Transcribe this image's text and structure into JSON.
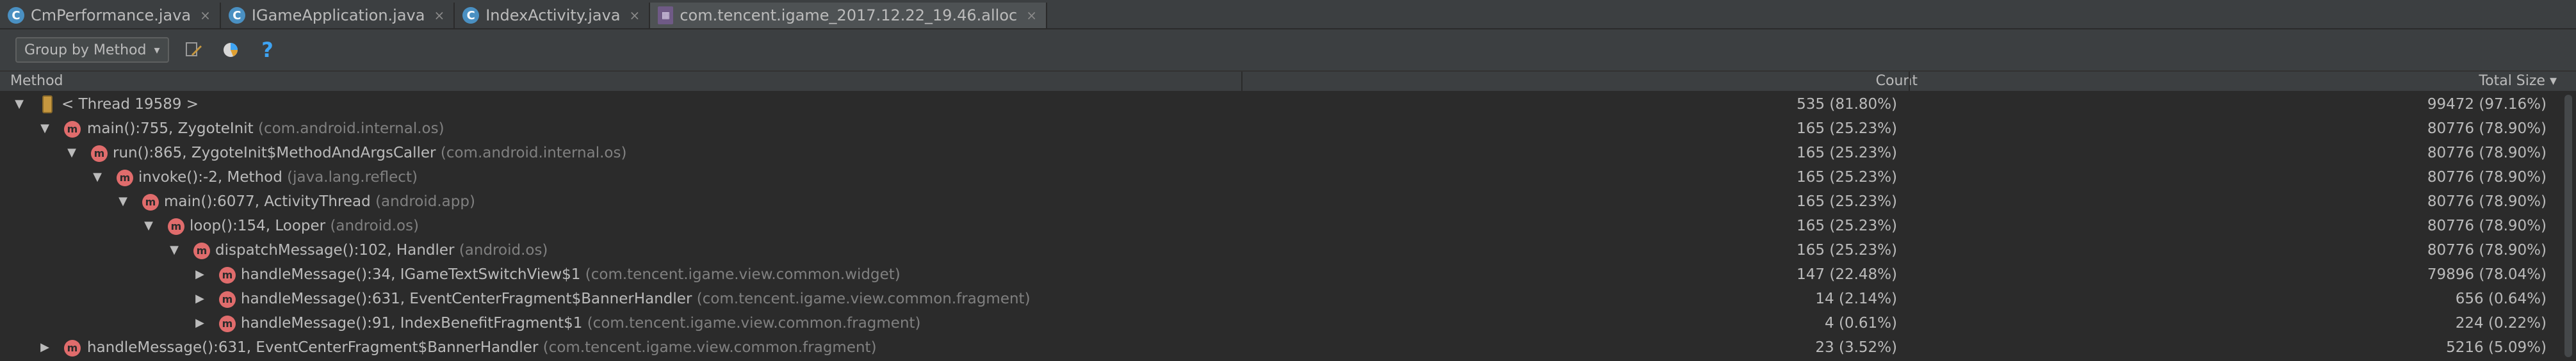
{
  "tabs": [
    {
      "label": "CmPerformance.java",
      "icon": "C",
      "active": false
    },
    {
      "label": "IGameApplication.java",
      "icon": "C",
      "active": false
    },
    {
      "label": "IndexActivity.java",
      "icon": "C",
      "active": false
    },
    {
      "label": "com.tencent.igame_2017.12.22_19.46.alloc",
      "icon": "file",
      "active": true
    }
  ],
  "tab_close_glyph": "×",
  "toolbar": {
    "group_by_label": "Group by Method",
    "help_glyph": "?"
  },
  "columns": {
    "method": "Method",
    "count": "Count",
    "total_size": "Total Size ▾"
  },
  "rows": [
    {
      "expanded": true,
      "level": 0,
      "icon": "thread",
      "name": "< Thread 19589 >",
      "pkg": "",
      "count": "535 (81.80%)",
      "size": "99472 (97.16%)"
    },
    {
      "expanded": true,
      "level": 1,
      "icon": "m",
      "name": "main():755, ZygoteInit",
      "pkg": "(com.android.internal.os)",
      "count": "165 (25.23%)",
      "size": "80776 (78.90%)"
    },
    {
      "expanded": true,
      "level": 2,
      "icon": "m",
      "name": "run():865, ZygoteInit$MethodAndArgsCaller",
      "pkg": "(com.android.internal.os)",
      "count": "165 (25.23%)",
      "size": "80776 (78.90%)"
    },
    {
      "expanded": true,
      "level": 3,
      "icon": "m",
      "name": "invoke():-2, Method",
      "pkg": "(java.lang.reflect)",
      "count": "165 (25.23%)",
      "size": "80776 (78.90%)"
    },
    {
      "expanded": true,
      "level": 4,
      "icon": "m",
      "name": "main():6077, ActivityThread",
      "pkg": "(android.app)",
      "count": "165 (25.23%)",
      "size": "80776 (78.90%)"
    },
    {
      "expanded": true,
      "level": 5,
      "icon": "m",
      "name": "loop():154, Looper",
      "pkg": "(android.os)",
      "count": "165 (25.23%)",
      "size": "80776 (78.90%)"
    },
    {
      "expanded": true,
      "level": 6,
      "icon": "m",
      "name": "dispatchMessage():102, Handler",
      "pkg": "(android.os)",
      "count": "165 (25.23%)",
      "size": "80776 (78.90%)"
    },
    {
      "expanded": false,
      "level": 7,
      "icon": "m",
      "name": "handleMessage():34, IGameTextSwitchView$1",
      "pkg": "(com.tencent.igame.view.common.widget)",
      "count": "147 (22.48%)",
      "size": "79896 (78.04%)"
    },
    {
      "expanded": false,
      "level": 7,
      "icon": "m",
      "name": "handleMessage():631, EventCenterFragment$BannerHandler",
      "pkg": "(com.tencent.igame.view.common.fragment)",
      "count": "14 (2.14%)",
      "size": "656 (0.64%)"
    },
    {
      "expanded": false,
      "level": 7,
      "icon": "m",
      "name": "handleMessage():91, IndexBenefitFragment$1",
      "pkg": "(com.tencent.igame.view.common.fragment)",
      "count": "4 (0.61%)",
      "size": "224 (0.22%)"
    },
    {
      "expanded": false,
      "level": 1,
      "icon": "m",
      "name": "handleMessage():631, EventCenterFragment$BannerHandler",
      "pkg": "(com.tencent.igame.view.common.fragment)",
      "count": "23 (3.52%)",
      "size": "5216 (5.09%)"
    }
  ],
  "colors": {
    "background": "#2b2b2b",
    "panel": "#3c3f41",
    "method_icon": "#e06c6c",
    "package_text": "#808080",
    "help_icon": "#3ea4f4"
  }
}
